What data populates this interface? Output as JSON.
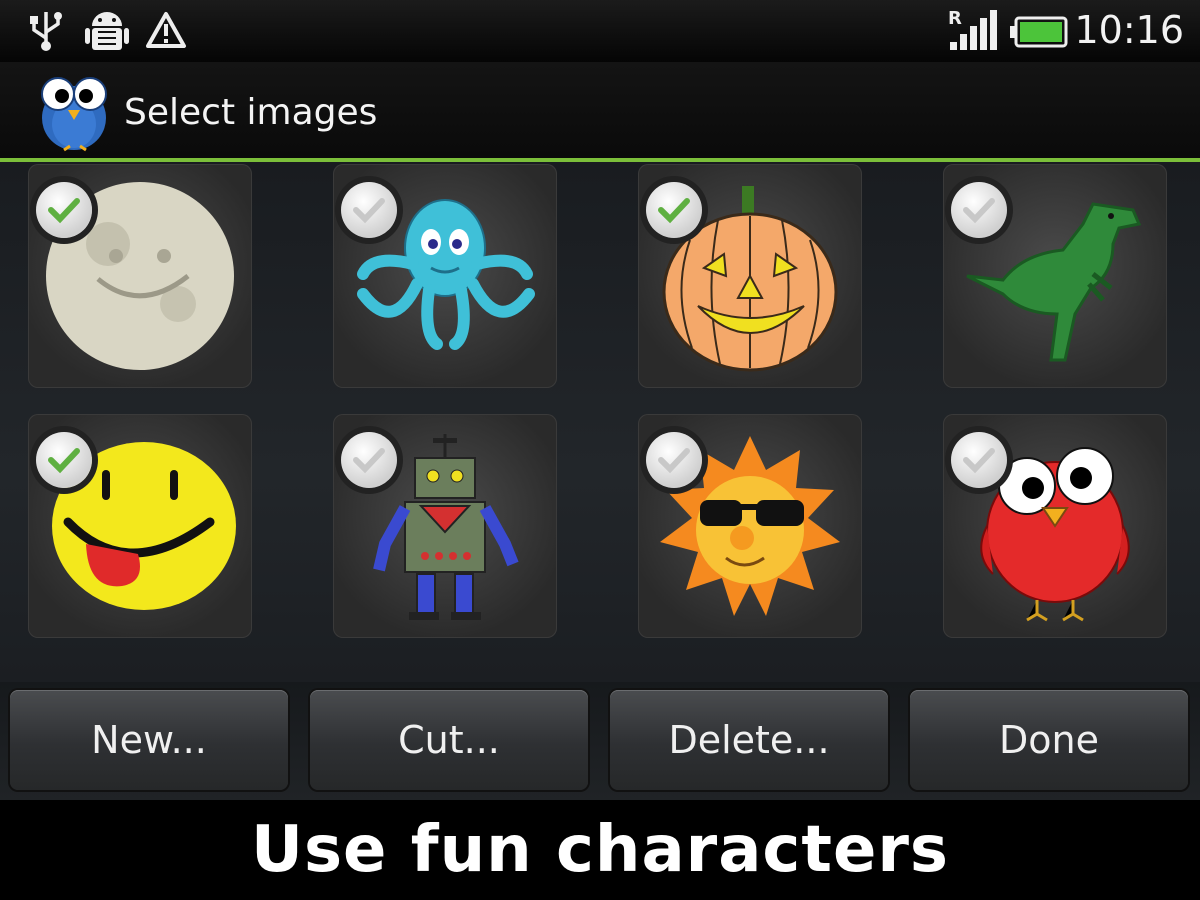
{
  "status_bar": {
    "time": "10:16",
    "icons": [
      "usb-icon",
      "android-debug-icon",
      "warning-icon",
      "signal-roaming-icon",
      "battery-icon"
    ],
    "roaming_letter": "R"
  },
  "app_bar": {
    "title": "Select images",
    "logo": "owl-logo-icon",
    "accent_color": "#7bbf3a"
  },
  "images": [
    {
      "name": "moon",
      "checked": true
    },
    {
      "name": "octopus-monster",
      "checked": false
    },
    {
      "name": "jack-o-lantern",
      "checked": true
    },
    {
      "name": "dinosaur",
      "checked": false
    },
    {
      "name": "smiley-face",
      "checked": true
    },
    {
      "name": "robot",
      "checked": false
    },
    {
      "name": "sun-with-sunglasses",
      "checked": false
    },
    {
      "name": "red-bird",
      "checked": false
    }
  ],
  "buttons": {
    "new": "New...",
    "cut": "Cut...",
    "delete": "Delete...",
    "done": "Done"
  },
  "caption": "Use fun characters",
  "colors": {
    "check_on": "#5fb041",
    "check_off": "#c8c8c8"
  }
}
